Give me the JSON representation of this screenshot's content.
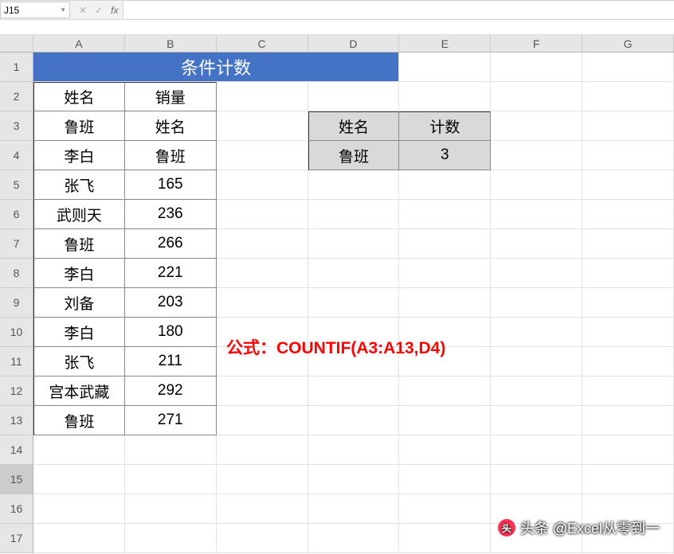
{
  "formula_bar": {
    "cell_ref": "J15",
    "fx_label": "fx",
    "formula": ""
  },
  "columns": [
    "A",
    "B",
    "C",
    "D",
    "E",
    "F",
    "G"
  ],
  "row_numbers": [
    "1",
    "2",
    "3",
    "4",
    "5",
    "6",
    "7",
    "8",
    "9",
    "10",
    "11",
    "12",
    "13",
    "14",
    "15",
    "16",
    "17"
  ],
  "merged_title": "条件计数",
  "table": {
    "header_a": "姓名",
    "header_b": "销量",
    "rows": [
      {
        "a": "鲁班",
        "b": "姓名"
      },
      {
        "a": "李白",
        "b": "鲁班"
      },
      {
        "a": "张飞",
        "b": "165"
      },
      {
        "a": "武则天",
        "b": "236"
      },
      {
        "a": "鲁班",
        "b": "266"
      },
      {
        "a": "李白",
        "b": "221"
      },
      {
        "a": "刘备",
        "b": "203"
      },
      {
        "a": "李白",
        "b": "180"
      },
      {
        "a": "张飞",
        "b": "211"
      },
      {
        "a": "宫本武藏",
        "b": "292"
      },
      {
        "a": "鲁班",
        "b": "271"
      }
    ]
  },
  "lookup": {
    "h1": "姓名",
    "h2": "计数",
    "v1": "鲁班",
    "v2": "3"
  },
  "annotation": "公式：COUNTIF(A3:A13,D4)",
  "watermark": "头条 @Excel从零到一",
  "active_cell_row": "15"
}
